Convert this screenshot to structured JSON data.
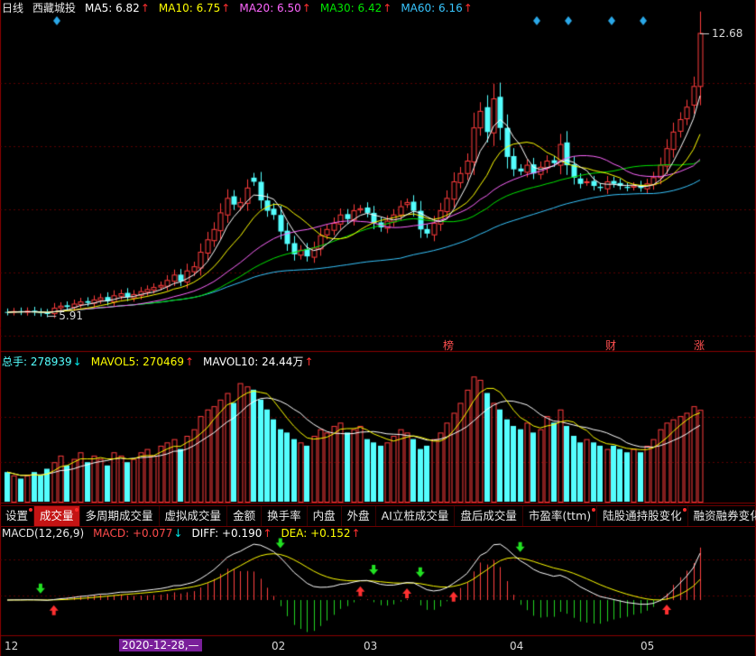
{
  "price_header": {
    "period": "日线",
    "stock": "西藏城投",
    "ma5": "MA5: 6.82",
    "ma10": "MA10: 6.75",
    "ma20": "MA20: 6.50",
    "ma30": "MA30: 6.42",
    "ma60": "MA60: 6.16",
    "up": "↑",
    "down": "↓"
  },
  "vol_header": {
    "total": "总手: 278939",
    "mavol5": "MAVOL5: 270469",
    "mavol10": "MAVOL10: 24.44万"
  },
  "macd_header": {
    "title": "MACD(12,26,9)",
    "macd": "MACD: +0.077",
    "diff": "DIFF: +0.190",
    "dea": "DEA: +0.152"
  },
  "tabs": [
    {
      "label": "设置",
      "dot": true,
      "active": false
    },
    {
      "label": "成交量",
      "dot": true,
      "active": true
    },
    {
      "label": "多周期成交量",
      "dot": false,
      "active": false
    },
    {
      "label": "虚拟成交量",
      "dot": false,
      "active": false
    },
    {
      "label": "金额",
      "dot": false,
      "active": false
    },
    {
      "label": "换手率",
      "dot": false,
      "active": false
    },
    {
      "label": "内盘",
      "dot": false,
      "active": false
    },
    {
      "label": "外盘",
      "dot": false,
      "active": false
    },
    {
      "label": "AI立桩成交量",
      "dot": false,
      "active": false
    },
    {
      "label": "盘后成交量",
      "dot": false,
      "active": false
    },
    {
      "label": "市盈率(ttm)",
      "dot": true,
      "active": false
    },
    {
      "label": "陆股通持股变化",
      "dot": true,
      "active": false
    },
    {
      "label": "融资融券变化",
      "dot": true,
      "active": false
    }
  ],
  "axis_labels": [
    "12",
    "2020-12-28,—",
    "02",
    "03",
    "04",
    "05"
  ],
  "price_markers": {
    "high": "12.68",
    "low": "5.91"
  },
  "event_tags": [
    "榜",
    "财",
    "涨"
  ],
  "colors": {
    "up": "#ff3c3c",
    "down": "#54ffff",
    "ma5": "#ffffff",
    "ma10": "#ffff00",
    "ma20": "#ff66ff",
    "ma30": "#00e600",
    "ma60": "#38c6ff",
    "grid": "#7a0000",
    "diamond": "#2aa8e8"
  },
  "chart_data": {
    "type": "candlestick",
    "close": [
      5.95,
      5.97,
      5.96,
      5.98,
      5.95,
      5.93,
      5.91,
      6.05,
      6.1,
      6.08,
      6.15,
      6.2,
      6.18,
      6.25,
      6.3,
      6.22,
      6.35,
      6.4,
      6.32,
      6.38,
      6.45,
      6.5,
      6.55,
      6.6,
      6.72,
      6.85,
      6.7,
      6.95,
      7.05,
      7.4,
      7.7,
      7.95,
      8.35,
      8.7,
      8.55,
      8.6,
      8.95,
      9.1,
      8.65,
      8.4,
      8.3,
      7.9,
      7.6,
      7.35,
      7.45,
      7.3,
      7.5,
      7.8,
      7.95,
      8.1,
      8.3,
      8.2,
      8.4,
      8.45,
      8.35,
      8.1,
      8.0,
      8.15,
      8.3,
      8.5,
      8.6,
      8.4,
      7.95,
      7.85,
      8.1,
      8.4,
      8.7,
      9.1,
      9.3,
      9.6,
      10.4,
      10.8,
      10.3,
      11.1,
      10.4,
      9.7,
      9.4,
      9.35,
      9.5,
      9.3,
      9.45,
      9.6,
      9.55,
      10.0,
      9.5,
      9.2,
      9.05,
      9.1,
      9.0,
      8.95,
      9.1,
      9.05,
      9.0,
      8.95,
      9.0,
      8.95,
      9.05,
      9.2,
      9.5,
      9.9,
      10.3,
      10.6,
      10.9,
      11.4,
      12.68
    ],
    "open": [
      5.96,
      5.95,
      5.98,
      5.95,
      5.99,
      5.96,
      5.94,
      5.92,
      6.06,
      6.12,
      6.07,
      6.14,
      6.22,
      6.17,
      6.24,
      6.32,
      6.2,
      6.34,
      6.42,
      6.3,
      6.36,
      6.44,
      6.49,
      6.56,
      6.58,
      6.7,
      6.86,
      6.68,
      6.93,
      7.02,
      7.38,
      7.68,
      7.92,
      8.3,
      8.75,
      8.5,
      8.58,
      9.2,
      9.1,
      8.65,
      8.45,
      8.3,
      7.92,
      7.62,
      7.33,
      7.48,
      7.28,
      7.48,
      7.82,
      7.93,
      8.08,
      8.32,
      8.18,
      8.42,
      8.48,
      8.35,
      8.12,
      7.98,
      8.13,
      8.3,
      8.55,
      8.62,
      8.4,
      7.96,
      7.82,
      8.08,
      8.38,
      8.68,
      9.08,
      9.3,
      9.58,
      10.4,
      10.9,
      10.28,
      11.15,
      10.4,
      9.72,
      9.42,
      9.33,
      9.52,
      9.28,
      9.43,
      9.62,
      9.5,
      10.05,
      9.52,
      9.18,
      9.08,
      9.12,
      8.98,
      8.93,
      9.12,
      9.07,
      8.98,
      8.97,
      9.02,
      8.93,
      9.03,
      9.2,
      9.48,
      9.88,
      10.32,
      10.62,
      10.95,
      11.4
    ],
    "volume": [
      9,
      8,
      7,
      8,
      9,
      8,
      10,
      12,
      14,
      11,
      13,
      15,
      12,
      14,
      13,
      11,
      15,
      14,
      12,
      13,
      15,
      16,
      14,
      17,
      18,
      19,
      16,
      20,
      22,
      26,
      28,
      29,
      31,
      33,
      30,
      36,
      35,
      34,
      31,
      28,
      25,
      22,
      21,
      19,
      18,
      17,
      20,
      22,
      21,
      23,
      24,
      21,
      22,
      23,
      19,
      18,
      17,
      18,
      20,
      22,
      21,
      19,
      16,
      17,
      19,
      21,
      24,
      27,
      30,
      34,
      38,
      37,
      33,
      30,
      28,
      25,
      23,
      22,
      24,
      21,
      22,
      26,
      24,
      28,
      23,
      20,
      18,
      19,
      18,
      17,
      16,
      17,
      16,
      15,
      16,
      15,
      17,
      19,
      22,
      24,
      25,
      26,
      27,
      29,
      27.89
    ],
    "ylim": [
      5.5,
      13.2
    ]
  }
}
